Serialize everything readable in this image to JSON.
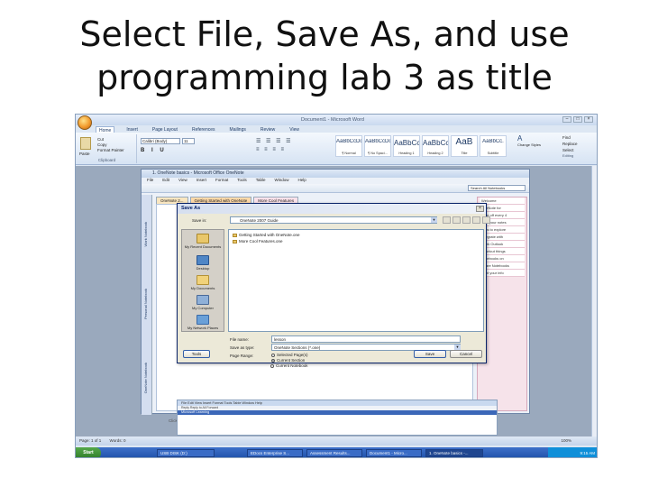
{
  "slide": {
    "title_line1": "Select File, Save As, and use",
    "title_line2": "programming lab 3 as title"
  },
  "word": {
    "window_title": "Document1 - Microsoft Word",
    "tabs": [
      "Home",
      "Insert",
      "Page Layout",
      "References",
      "Mailings",
      "Review",
      "View"
    ],
    "clipboard": {
      "paste": "Paste",
      "cut": "Cut",
      "copy": "Copy",
      "format_painter": "Format Painter",
      "label": "Clipboard"
    },
    "font": {
      "name": "Calibri (Body)",
      "size": "11"
    },
    "styles": [
      {
        "sample": "AaBbCcDc",
        "name": "¶ Normal"
      },
      {
        "sample": "AaBbCcDc",
        "name": "¶ No Spaci..."
      },
      {
        "sample": "AaBbCc",
        "name": "Heading 1"
      },
      {
        "sample": "AaBbCc",
        "name": "Heading 2"
      },
      {
        "sample": "AaB",
        "name": "Title"
      },
      {
        "sample": "AaBbCc.",
        "name": "Subtitle"
      }
    ],
    "editing": {
      "find": "Find",
      "replace": "Replace",
      "select": "Select",
      "change_styles": "Change Styles",
      "label": "Editing"
    },
    "status": {
      "page": "Page: 1 of 1",
      "words": "Words: 0",
      "zoom": "100%"
    }
  },
  "onenote": {
    "title": "1. OneNote basics - Microsoft Office OneNote",
    "menu": [
      "File",
      "Edit",
      "View",
      "Insert",
      "Format",
      "Tools",
      "Table",
      "Window",
      "Help"
    ],
    "search": "Search All Notebooks",
    "notebooks": [
      "OneNote Notebook",
      "Personal Notebook",
      "Work Notebook"
    ],
    "sections": [
      "OneNote 2...",
      "Getting Started with OneNote",
      "More Cool Features"
    ],
    "pages": [
      "Welcome",
      "OneNote for",
      "Take off every 4",
      "Find your notes",
      "Tabs to explore",
      "Integrate with",
      "Work Outlook",
      "Shortcut things",
      "Notebooks on",
      "Share Notebooks",
      "Print your info"
    ],
    "footer": "Click outlook to add page notes"
  },
  "save_as": {
    "title": "Save As",
    "save_in_label": "Save in:",
    "save_in_value": "OneNote 2007 Guide",
    "places": [
      "My Recent Documents",
      "Desktop",
      "My Documents",
      "My Computer",
      "My Network Places"
    ],
    "files": [
      "Getting Started with OneNote.one",
      "More Cool Features.one"
    ],
    "file_name_label": "File name:",
    "file_name_value": "lesson",
    "save_type_label": "Save as type:",
    "save_type_value": "OneNote Sections (*.one)",
    "page_range_label": "Page Range:",
    "range_options": [
      "Selected Page(s)",
      "Current Section",
      "Current Notebook"
    ],
    "range_selected": 1,
    "tools_label": "Tools",
    "save_label": "Save",
    "cancel_label": "Cancel"
  },
  "mini_window": {
    "menu": "File  Edit  View  Insert  Format  Tools  Table  Window  Help",
    "row2": "Reply  Reply to All  Forward",
    "link": "Microsoft Learning"
  },
  "taskbar": {
    "start": "Start",
    "tasks": [
      "USB DISK (D:)",
      "EDocs Enterprise S...",
      "Assessment Results...",
      "Document1 - Micro...",
      "1. OneNote basics -..."
    ],
    "active_task": 4,
    "time": "9:15 AM"
  }
}
